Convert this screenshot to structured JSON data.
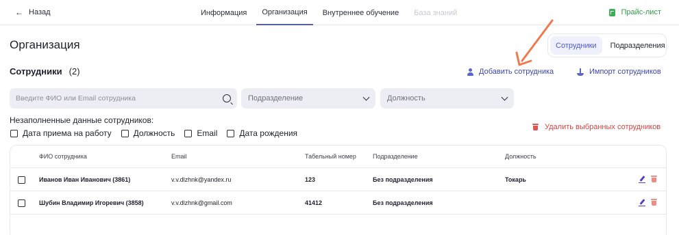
{
  "nav": {
    "back_label": "Назад",
    "tabs": [
      {
        "label": "Информация",
        "state": "normal"
      },
      {
        "label": "Организация",
        "state": "active"
      },
      {
        "label": "Внутреннее обучение",
        "state": "normal"
      },
      {
        "label": "База знаний",
        "state": "disabled"
      }
    ],
    "price_list_label": "Прайс-лист"
  },
  "page": {
    "title": "Организация",
    "segment": {
      "employees": "Сотрудники",
      "departments": "Подразделения",
      "active": "employees"
    }
  },
  "employees_section": {
    "title": "Сотрудники",
    "count": "(2)",
    "add_label": "Добавить сотрудника",
    "import_label": "Импорт сотрудников"
  },
  "filters": {
    "search_placeholder": "Введите ФИО или Email сотрудника",
    "department_label": "Подразделение",
    "position_label": "Должность"
  },
  "incomplete": {
    "label": "Незаполненные данные сотрудников:",
    "options": [
      "Дата приема на работу",
      "Должность",
      "Email",
      "Дата рождения"
    ]
  },
  "delete_selected_label": "Удалить выбранных сотрудников",
  "table": {
    "columns": [
      "ФИО сотрудника",
      "Email",
      "Табельный номер",
      "Подразделение",
      "Должность"
    ],
    "rows": [
      {
        "name": "Иванов Иван Иванович (3861)",
        "email": "v.v.dlzhnk@yandex.ru",
        "number": "123",
        "department": "Без подразделения",
        "position": "Токарь"
      },
      {
        "name": "Шубин Владимир Игоревич (3858)",
        "email": "v.v.dlzhnk@gmail.com",
        "number": "41412",
        "department": "Без подразделения",
        "position": ""
      }
    ]
  },
  "colors": {
    "accent": "#4d5bc7",
    "danger": "#d9423f",
    "success": "#2f9e47",
    "annotation": "#ef7a50"
  }
}
